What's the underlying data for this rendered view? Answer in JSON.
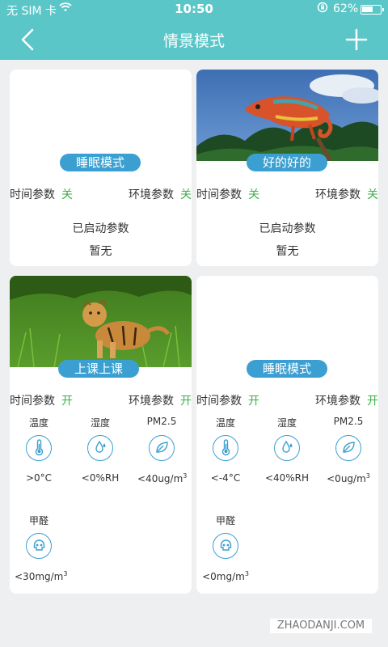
{
  "status_bar": {
    "carrier": "无 SIM 卡",
    "time": "10:50",
    "battery": "62%",
    "battery_level": 0.62
  },
  "nav": {
    "title": "情景模式"
  },
  "cards": [
    {
      "name": "睡眠模式",
      "time_param_label": "时间参数",
      "time_param_state": "关",
      "env_param_label": "环境参数",
      "env_param_state": "关",
      "started_label": "已启动参数",
      "started_value": "暂无"
    },
    {
      "name": "好的好的",
      "time_param_label": "时间参数",
      "time_param_state": "关",
      "env_param_label": "环境参数",
      "env_param_state": "关",
      "started_label": "已启动参数",
      "started_value": "暂无"
    },
    {
      "name": "上课上课",
      "time_param_label": "时间参数",
      "time_param_state": "开",
      "env_param_label": "环境参数",
      "env_param_state": "开",
      "env": [
        {
          "label": "温度",
          "value": ">0°C",
          "icon": "thermometer-icon"
        },
        {
          "label": "湿度",
          "value": "<0%RH",
          "icon": "humidity-drop-icon"
        },
        {
          "label": "PM2.5",
          "value": "<40ug/m",
          "sup": "3",
          "icon": "leaf-icon"
        },
        {
          "label": "甲醛",
          "value": "<30mg/m",
          "sup": "3",
          "icon": "skull-icon"
        }
      ]
    },
    {
      "name": "睡眠模式",
      "time_param_label": "时间参数",
      "time_param_state": "开",
      "env_param_label": "环境参数",
      "env_param_state": "开",
      "env": [
        {
          "label": "温度",
          "value": "<-4°C",
          "icon": "thermometer-icon"
        },
        {
          "label": "湿度",
          "value": "<40%RH",
          "icon": "humidity-drop-icon"
        },
        {
          "label": "PM2.5",
          "value": "<0ug/m",
          "sup": "3",
          "icon": "leaf-icon"
        },
        {
          "label": "甲醛",
          "value": "<0mg/m",
          "sup": "3",
          "icon": "skull-icon"
        }
      ]
    }
  ],
  "watermark": "ZHAODANJI.COM",
  "colors": {
    "primary": "#5bc6c8",
    "badge": "#3ba0d1",
    "state_on": "#3cb04a"
  }
}
